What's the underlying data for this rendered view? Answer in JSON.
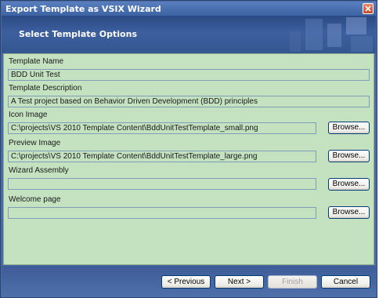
{
  "window": {
    "title": "Export Template as VSIX Wizard"
  },
  "banner": {
    "heading": "Select Template Options"
  },
  "form": {
    "template_name": {
      "label": "Template Name",
      "value": "BDD Unit Test"
    },
    "template_description": {
      "label": "Template Description",
      "value": "A Test project based on Behavior Driven Development (BDD) principles"
    },
    "icon_image": {
      "label": "Icon Image",
      "value": "C:\\projects\\VS 2010 Template Content\\BddUnitTestTemplate_small.png",
      "browse_label": "Browse..."
    },
    "preview_image": {
      "label": "Preview Image",
      "value": "C:\\projects\\VS 2010 Template Content\\BddUnitTestTemplate_large.png",
      "browse_label": "Browse..."
    },
    "wizard_assembly": {
      "label": "Wizard Assembly",
      "value": "",
      "browse_label": "Browse..."
    },
    "welcome_page": {
      "label": "Welcome page",
      "value": "",
      "browse_label": "Browse..."
    }
  },
  "footer": {
    "previous_label": "< Previous",
    "next_label": "Next >",
    "finish_label": "Finish",
    "cancel_label": "Cancel"
  },
  "colors": {
    "content_bg": "#c4e2c0",
    "banner_bg": "#3d5f9e",
    "field_border": "#7f9db9"
  }
}
